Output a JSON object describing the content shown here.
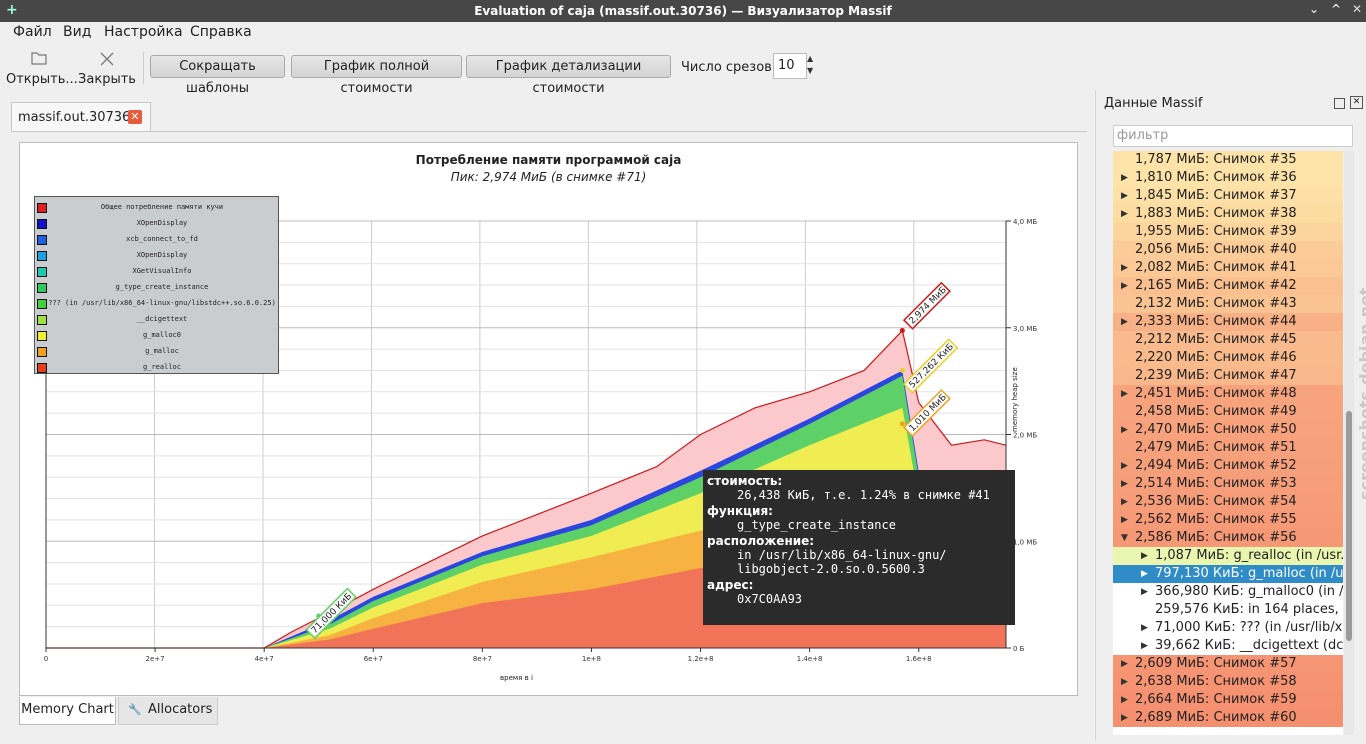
{
  "window": {
    "title": "Evaluation of caja (massif.out.30736) — Визуализатор Massif",
    "controls": [
      "⌄",
      "^",
      "✕"
    ]
  },
  "menu": [
    "Файл",
    "Вид",
    "Настройка",
    "Справка"
  ],
  "toolbar": {
    "open_label": "Открыть...",
    "close_label": "Закрыть",
    "shorten_templates": "Сокращать шаблоны",
    "total_cost_graph": "График полной стоимости",
    "detail_cost_graph": "График детализации стоимости",
    "snapshots_label": "Число срезов:",
    "snapshots_value": "10"
  },
  "doc_tab": {
    "label": "massif.out.30736"
  },
  "bottom_tabs": {
    "memory_chart": "Memory Chart",
    "allocators": "Allocators"
  },
  "dock": {
    "title": "Данные Massif",
    "filter_placeholder": "фильтр"
  },
  "chart_data": {
    "type": "area",
    "title": "Потребление памяти программой caja",
    "subtitle": "Пик: 2,974 МиБ (в снимке #71)",
    "xlabel": "время в i",
    "ylabel": "memory heap size",
    "x_ticks": [
      "0",
      "2e+7",
      "4e+7",
      "6e+7",
      "8e+7",
      "1e+8",
      "1.2e+8",
      "1.4e+8",
      "1.6e+8"
    ],
    "y_ticks": [
      "0 Б",
      "1,0 МБ",
      "2,0 МБ",
      "3,0 МБ",
      "4,0 МБ"
    ],
    "xlim": [
      0,
      176000000
    ],
    "ylim": [
      0,
      4
    ],
    "legend": [
      {
        "name": "Общее потребление памяти кучи",
        "color": "#e02020"
      },
      {
        "name": "XOpenDisplay",
        "color": "#1010c8"
      },
      {
        "name": "xcb_connect_to_fd",
        "color": "#2060e0"
      },
      {
        "name": "XOpenDisplay",
        "color": "#20a0e0"
      },
      {
        "name": "XGetVisualInfo",
        "color": "#20c8b0"
      },
      {
        "name": "g_type_create_instance",
        "color": "#30c860"
      },
      {
        "name": "??? (in /usr/lib/x86_64-linux-gnu/libstdc++.so.6.0.25)",
        "color": "#40d040"
      },
      {
        "name": "__dcigettext",
        "color": "#a0e040"
      },
      {
        "name": "g_malloc0",
        "color": "#f0f030"
      },
      {
        "name": "g_malloc",
        "color": "#f0a020"
      },
      {
        "name": "g_realloc",
        "color": "#e04020"
      }
    ],
    "total_points": [
      [
        0,
        0
      ],
      [
        40000000,
        0
      ],
      [
        45000000,
        0.15
      ],
      [
        50000000,
        0.28
      ],
      [
        52000000,
        0.33
      ],
      [
        60000000,
        0.55
      ],
      [
        70000000,
        0.8
      ],
      [
        80000000,
        1.05
      ],
      [
        90000000,
        1.25
      ],
      [
        100000000,
        1.45
      ],
      [
        112000000,
        1.7
      ],
      [
        120000000,
        2.0
      ],
      [
        130000000,
        2.25
      ],
      [
        140000000,
        2.4
      ],
      [
        150000000,
        2.6
      ],
      [
        157000000,
        2.974
      ],
      [
        160000000,
        2.3
      ],
      [
        166000000,
        1.9
      ],
      [
        172000000,
        1.95
      ],
      [
        176000000,
        1.9
      ]
    ],
    "layers": [
      {
        "name": "g_realloc",
        "color": "#f0705a",
        "points": [
          [
            0,
            0
          ],
          [
            40000000,
            0
          ],
          [
            52000000,
            0.08
          ],
          [
            60000000,
            0.18
          ],
          [
            80000000,
            0.42
          ],
          [
            100000000,
            0.55
          ],
          [
            120000000,
            0.75
          ],
          [
            140000000,
            0.85
          ],
          [
            157000000,
            1.0
          ],
          [
            160000000,
            0.6
          ],
          [
            176000000,
            0.6
          ]
        ]
      },
      {
        "name": "g_malloc",
        "color": "#f7b040",
        "points": [
          [
            0,
            0
          ],
          [
            40000000,
            0
          ],
          [
            52000000,
            0.12
          ],
          [
            60000000,
            0.28
          ],
          [
            80000000,
            0.62
          ],
          [
            100000000,
            0.85
          ],
          [
            120000000,
            1.1
          ],
          [
            140000000,
            1.35
          ],
          [
            157000000,
            1.55
          ],
          [
            160000000,
            1.0
          ],
          [
            176000000,
            1.0
          ]
        ]
      },
      {
        "name": "g_malloc0",
        "color": "#f7ee50",
        "points": [
          [
            0,
            0
          ],
          [
            40000000,
            0
          ],
          [
            52000000,
            0.18
          ],
          [
            60000000,
            0.38
          ],
          [
            80000000,
            0.78
          ],
          [
            100000000,
            1.05
          ],
          [
            120000000,
            1.45
          ],
          [
            140000000,
            1.9
          ],
          [
            157000000,
            2.25
          ],
          [
            160000000,
            1.4
          ],
          [
            176000000,
            1.4
          ]
        ]
      },
      {
        "name": "g_type_create_instance",
        "color": "#60d860",
        "points": [
          [
            0,
            0
          ],
          [
            40000000,
            0
          ],
          [
            52000000,
            0.22
          ],
          [
            60000000,
            0.44
          ],
          [
            80000000,
            0.86
          ],
          [
            100000000,
            1.15
          ],
          [
            120000000,
            1.6
          ],
          [
            140000000,
            2.1
          ],
          [
            157000000,
            2.55
          ],
          [
            160000000,
            1.6
          ],
          [
            176000000,
            1.6
          ]
        ]
      },
      {
        "name": "XOpenDisplay",
        "color": "#2040e0",
        "points": [
          [
            0,
            0
          ],
          [
            40000000,
            0
          ],
          [
            52000000,
            0.26
          ],
          [
            60000000,
            0.48
          ],
          [
            80000000,
            0.9
          ],
          [
            100000000,
            1.2
          ],
          [
            120000000,
            1.66
          ],
          [
            140000000,
            2.15
          ],
          [
            157000000,
            2.6
          ],
          [
            160000000,
            1.65
          ],
          [
            176000000,
            1.65
          ]
        ]
      }
    ],
    "annotations": [
      "2,974 МиБ",
      "527,262 КиБ",
      "1,010 МиБ",
      "71,000 КиБ"
    ]
  },
  "tooltip": {
    "cost_label": "стоимость:",
    "cost_value": "26,438 КиБ, т.е. 1.24% в снимке #41",
    "function_label": "функция:",
    "function_value": "g_type_create_instance",
    "location_label": "расположение:",
    "location_value1": "in /usr/lib/x86_64-linux-gnu/",
    "location_value2": "libgobject-2.0.so.0.5600.3",
    "address_label": "адрес:",
    "address_value": "0x7C0AA93"
  },
  "tree": [
    {
      "text": "1,787 МиБ: Снимок #35",
      "arrow": "",
      "indent": 0,
      "bg": "#fde3a8"
    },
    {
      "text": "1,810 МиБ: Снимок #36",
      "arrow": "▶",
      "indent": 0,
      "bg": "#fde3a8"
    },
    {
      "text": "1,845 МиБ: Снимок #37",
      "arrow": "▶",
      "indent": 0,
      "bg": "#fde0a5"
    },
    {
      "text": "1,883 МиБ: Снимок #38",
      "arrow": "▶",
      "indent": 0,
      "bg": "#fddca2"
    },
    {
      "text": "1,955 МиБ: Снимок #39",
      "arrow": "",
      "indent": 0,
      "bg": "#fcd59e"
    },
    {
      "text": "2,056 МиБ: Снимок #40",
      "arrow": "",
      "indent": 0,
      "bg": "#fbcb98"
    },
    {
      "text": "2,082 МиБ: Снимок #41",
      "arrow": "▶",
      "indent": 0,
      "bg": "#fbc896"
    },
    {
      "text": "2,165 МиБ: Снимок #42",
      "arrow": "▶",
      "indent": 0,
      "bg": "#fac090"
    },
    {
      "text": "2,132 МиБ: Снимок #43",
      "arrow": "",
      "indent": 0,
      "bg": "#fac392"
    },
    {
      "text": "2,333 МиБ: Снимок #44",
      "arrow": "▶",
      "indent": 0,
      "bg": "#f8b086"
    },
    {
      "text": "2,212 МиБ: Снимок #45",
      "arrow": "",
      "indent": 0,
      "bg": "#f9bb8d"
    },
    {
      "text": "2,220 МиБ: Снимок #46",
      "arrow": "",
      "indent": 0,
      "bg": "#f9ba8c"
    },
    {
      "text": "2,239 МиБ: Снимок #47",
      "arrow": "",
      "indent": 0,
      "bg": "#f9b88b"
    },
    {
      "text": "2,451 МиБ: Снимок #48",
      "arrow": "▶",
      "indent": 0,
      "bg": "#f7a47e"
    },
    {
      "text": "2,458 МиБ: Снимок #49",
      "arrow": "",
      "indent": 0,
      "bg": "#f7a47e"
    },
    {
      "text": "2,470 МиБ: Снимок #50",
      "arrow": "▶",
      "indent": 0,
      "bg": "#f7a27d"
    },
    {
      "text": "2,479 МиБ: Снимок #51",
      "arrow": "",
      "indent": 0,
      "bg": "#f7a17c"
    },
    {
      "text": "2,494 МиБ: Снимок #52",
      "arrow": "▶",
      "indent": 0,
      "bg": "#f6a07b"
    },
    {
      "text": "2,514 МиБ: Снимок #53",
      "arrow": "▶",
      "indent": 0,
      "bg": "#f69e7a"
    },
    {
      "text": "2,536 МиБ: Снимок #54",
      "arrow": "▶",
      "indent": 0,
      "bg": "#f69c78"
    },
    {
      "text": "2,562 МиБ: Снимок #55",
      "arrow": "▶",
      "indent": 0,
      "bg": "#f69a77"
    },
    {
      "text": "2,586 МиБ: Снимок #56",
      "arrow": "▼",
      "indent": 0,
      "bg": "#f59875"
    },
    {
      "text": "1,087 МиБ: g_realloc (in /usr...",
      "arrow": "▶",
      "indent": 1,
      "bg": "#e8f6b0"
    },
    {
      "text": "797,130 КиБ: g_malloc (in /u...",
      "arrow": "▶",
      "indent": 1,
      "bg": "#308cc6",
      "selected": true
    },
    {
      "text": "366,980 КиБ: g_malloc0 (in /...",
      "arrow": "▶",
      "indent": 1,
      "bg": "#ffffff"
    },
    {
      "text": "259,576 КиБ: in 164 places, a...",
      "arrow": "",
      "indent": 1,
      "bg": "#ffffff"
    },
    {
      "text": "71,000 КиБ: ??? (in /usr/lib/x...",
      "arrow": "▶",
      "indent": 1,
      "bg": "#ffffff"
    },
    {
      "text": "39,662 КиБ: __dcigettext (dc...",
      "arrow": "▶",
      "indent": 1,
      "bg": "#ffffff"
    },
    {
      "text": "2,609 МиБ: Снимок #57",
      "arrow": "▶",
      "indent": 0,
      "bg": "#f59574"
    },
    {
      "text": "2,638 МиБ: Снимок #58",
      "arrow": "▶",
      "indent": 0,
      "bg": "#f59372"
    },
    {
      "text": "2,664 МиБ: Снимок #59",
      "arrow": "▶",
      "indent": 0,
      "bg": "#f59171"
    },
    {
      "text": "2,689 МиБ: Снимок #60",
      "arrow": "▶",
      "indent": 0,
      "bg": "#f48f6f"
    }
  ],
  "watermark": "screenshots.debian.net"
}
